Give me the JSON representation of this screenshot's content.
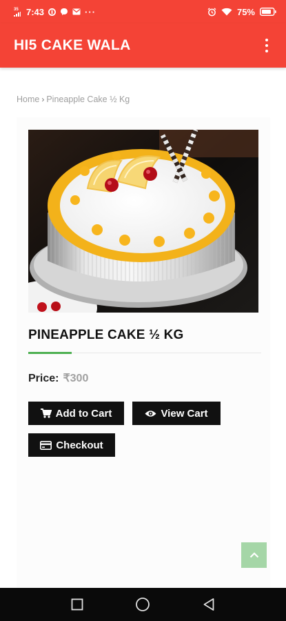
{
  "status_bar": {
    "time": "7:43",
    "network": "35",
    "battery": "75%"
  },
  "app_bar": {
    "title": "HI5 CAKE WALA",
    "menu_icon": "more-vertical-icon"
  },
  "breadcrumb": {
    "home": "Home",
    "separator": "›",
    "current": "Pineapple Cake ½ Kg"
  },
  "product": {
    "title": "PINEAPPLE CAKE ½ KG",
    "price_label": "Price:",
    "price": "₹300"
  },
  "buttons": {
    "add_to_cart": "Add to Cart",
    "view_cart": "View Cart",
    "checkout": "Checkout"
  },
  "colors": {
    "header": "#f44336",
    "button": "#111111",
    "accent": "#4caf50",
    "scroll_top": "#a5d6a7"
  },
  "icons": {
    "add_to_cart": "cart-icon",
    "view_cart": "eye-icon",
    "checkout": "credit-card-icon",
    "scroll_top": "chevron-up-icon",
    "nav": [
      "recents-square-icon",
      "home-circle-icon",
      "back-triangle-icon"
    ]
  }
}
